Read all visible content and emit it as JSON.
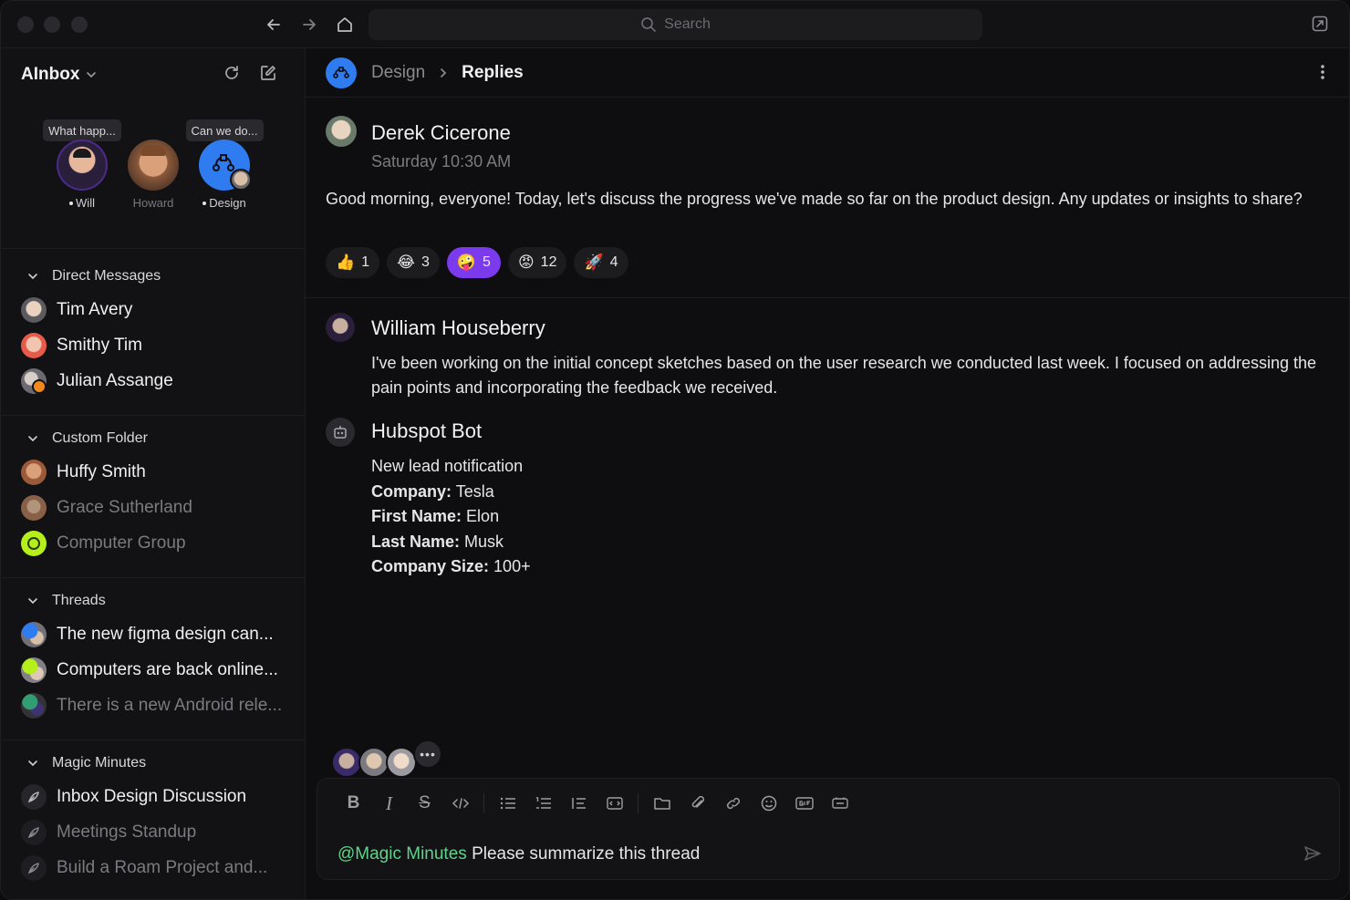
{
  "titlebar": {
    "search_placeholder": "Search"
  },
  "sidebar": {
    "title": "AInbox",
    "stories": [
      {
        "bubble": "What happ...",
        "name": "Will",
        "online": true
      },
      {
        "bubble": "",
        "name": "Howard",
        "online": false
      },
      {
        "bubble": "Can we do...",
        "name": "Design",
        "online": true
      }
    ],
    "direct_messages": {
      "label": "Direct Messages",
      "items": [
        {
          "name": "Tim Avery",
          "dim": false
        },
        {
          "name": "Smithy Tim",
          "dim": false
        },
        {
          "name": "Julian Assange",
          "dim": false
        }
      ]
    },
    "custom_folder": {
      "label": "Custom Folder",
      "items": [
        {
          "name": "Huffy Smith",
          "dim": false
        },
        {
          "name": "Grace Sutherland",
          "dim": true
        },
        {
          "name": "Computer Group",
          "dim": true
        }
      ]
    },
    "threads": {
      "label": "Threads",
      "items": [
        {
          "name": "The new figma design can...",
          "dim": false
        },
        {
          "name": "Computers are back online...",
          "dim": false
        },
        {
          "name": "There is a new Android rele...",
          "dim": true
        }
      ]
    },
    "magic_minutes": {
      "label": "Magic Minutes",
      "items": [
        {
          "name": "Inbox Design Discussion",
          "dim": false
        },
        {
          "name": "Meetings Standup",
          "dim": true
        },
        {
          "name": "Build a Roam Project and...",
          "dim": true
        }
      ]
    }
  },
  "main": {
    "breadcrumb": {
      "parent": "Design",
      "current": "Replies"
    },
    "messages": [
      {
        "author": "Derek Cicerone",
        "time": "Saturday 10:30 AM",
        "text": "Good morning, everyone! Today, let's discuss the progress we've made so far on the product design. Any updates or insights to share?",
        "reactions": [
          {
            "emoji": "👍",
            "count": "1",
            "active": false
          },
          {
            "emoji": "😂",
            "count": "3",
            "active": false
          },
          {
            "emoji": "🤪",
            "count": "5",
            "active": true
          },
          {
            "emoji": "😡",
            "count": "12",
            "active": false
          },
          {
            "emoji": "🚀",
            "count": "4",
            "active": false
          }
        ]
      },
      {
        "author": "William Houseberry",
        "text": "I've been working on the initial concept sketches based on the user research we conducted last week. I focused on addressing the pain points and incorporating the feedback we received."
      },
      {
        "author": "Hubspot Bot",
        "title": "New lead notification",
        "fields": [
          {
            "label": "Company:",
            "value": "Tesla"
          },
          {
            "label": "First Name:",
            "value": "Elon"
          },
          {
            "label": "Last Name:",
            "value": "Musk"
          },
          {
            "label": "Company Size:",
            "value": "100+"
          }
        ]
      }
    ],
    "composer": {
      "mention": "@Magic Minutes",
      "text": "Please summarize this thread"
    }
  },
  "colors": {
    "accent_blue": "#2f7bf0",
    "reaction_active": "#7c3aed",
    "mention": "#5fd38a",
    "background": "#0e0e10"
  }
}
